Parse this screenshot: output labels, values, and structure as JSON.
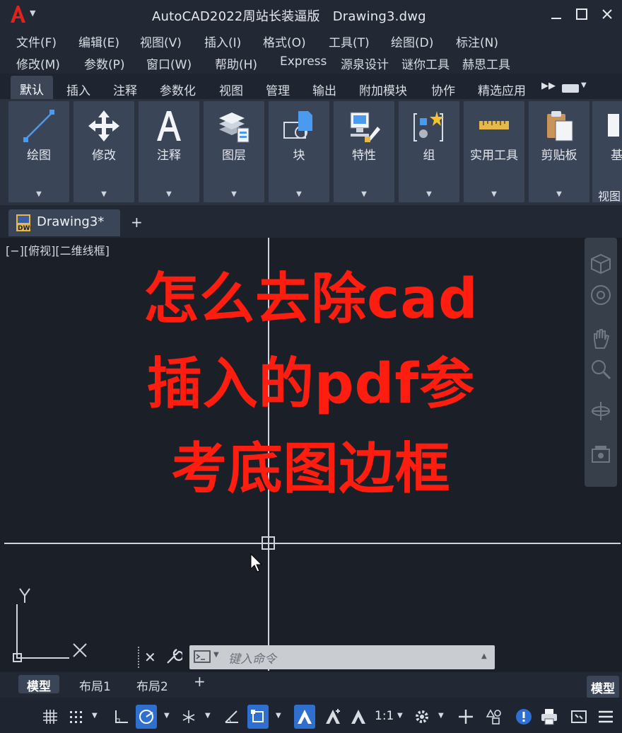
{
  "titlebar": {
    "app_name": "AutoCAD2022周站长装逼版",
    "file_name": "Drawing3.dwg",
    "logo_letter": "A",
    "min_icon": "minimize-icon",
    "max_icon": "maximize-icon",
    "close_icon": "close-icon"
  },
  "menu": {
    "row1": [
      "文件(F)",
      "编辑(E)",
      "视图(V)",
      "插入(I)",
      "格式(O)",
      "工具(T)",
      "绘图(D)",
      "标注(N)"
    ],
    "row2": [
      "修改(M)",
      "参数(P)",
      "窗口(W)",
      "帮助(H)",
      "Express",
      "源泉设计",
      "谜你工具",
      "赫思工具"
    ]
  },
  "ribbon_tabs": [
    "默认",
    "插入",
    "注释",
    "参数化",
    "视图",
    "管理",
    "输出",
    "附加模块",
    "协作",
    "精选应用"
  ],
  "ribbon_panels": [
    "绘图",
    "修改",
    "注释",
    "图层",
    "块",
    "特性",
    "组",
    "实用工具",
    "剪贴板"
  ],
  "ribbon_partial": {
    "label": "视图",
    "label_top": "基"
  },
  "doc_tab": {
    "label": "Drawing3*",
    "add": "+"
  },
  "viewport_label": "[−][俯视][二维线框]",
  "overlay": {
    "line1": "怎么去除cad",
    "line2": "插入的pdf参",
    "line3": "考底图边框",
    "color": "#ff1d10"
  },
  "ucs": {
    "x_label": "X",
    "y_label": "Y"
  },
  "command": {
    "placeholder": "键入命令",
    "close": "✕"
  },
  "layout_tabs": [
    "模型",
    "布局1",
    "布局2"
  ],
  "layout_add": "+",
  "model_button": "模型",
  "status": {
    "scale": "1:1"
  },
  "colors": {
    "accent": "#2f6fd0",
    "overlay_text": "#ff1d10",
    "panel": "#3b4558"
  }
}
